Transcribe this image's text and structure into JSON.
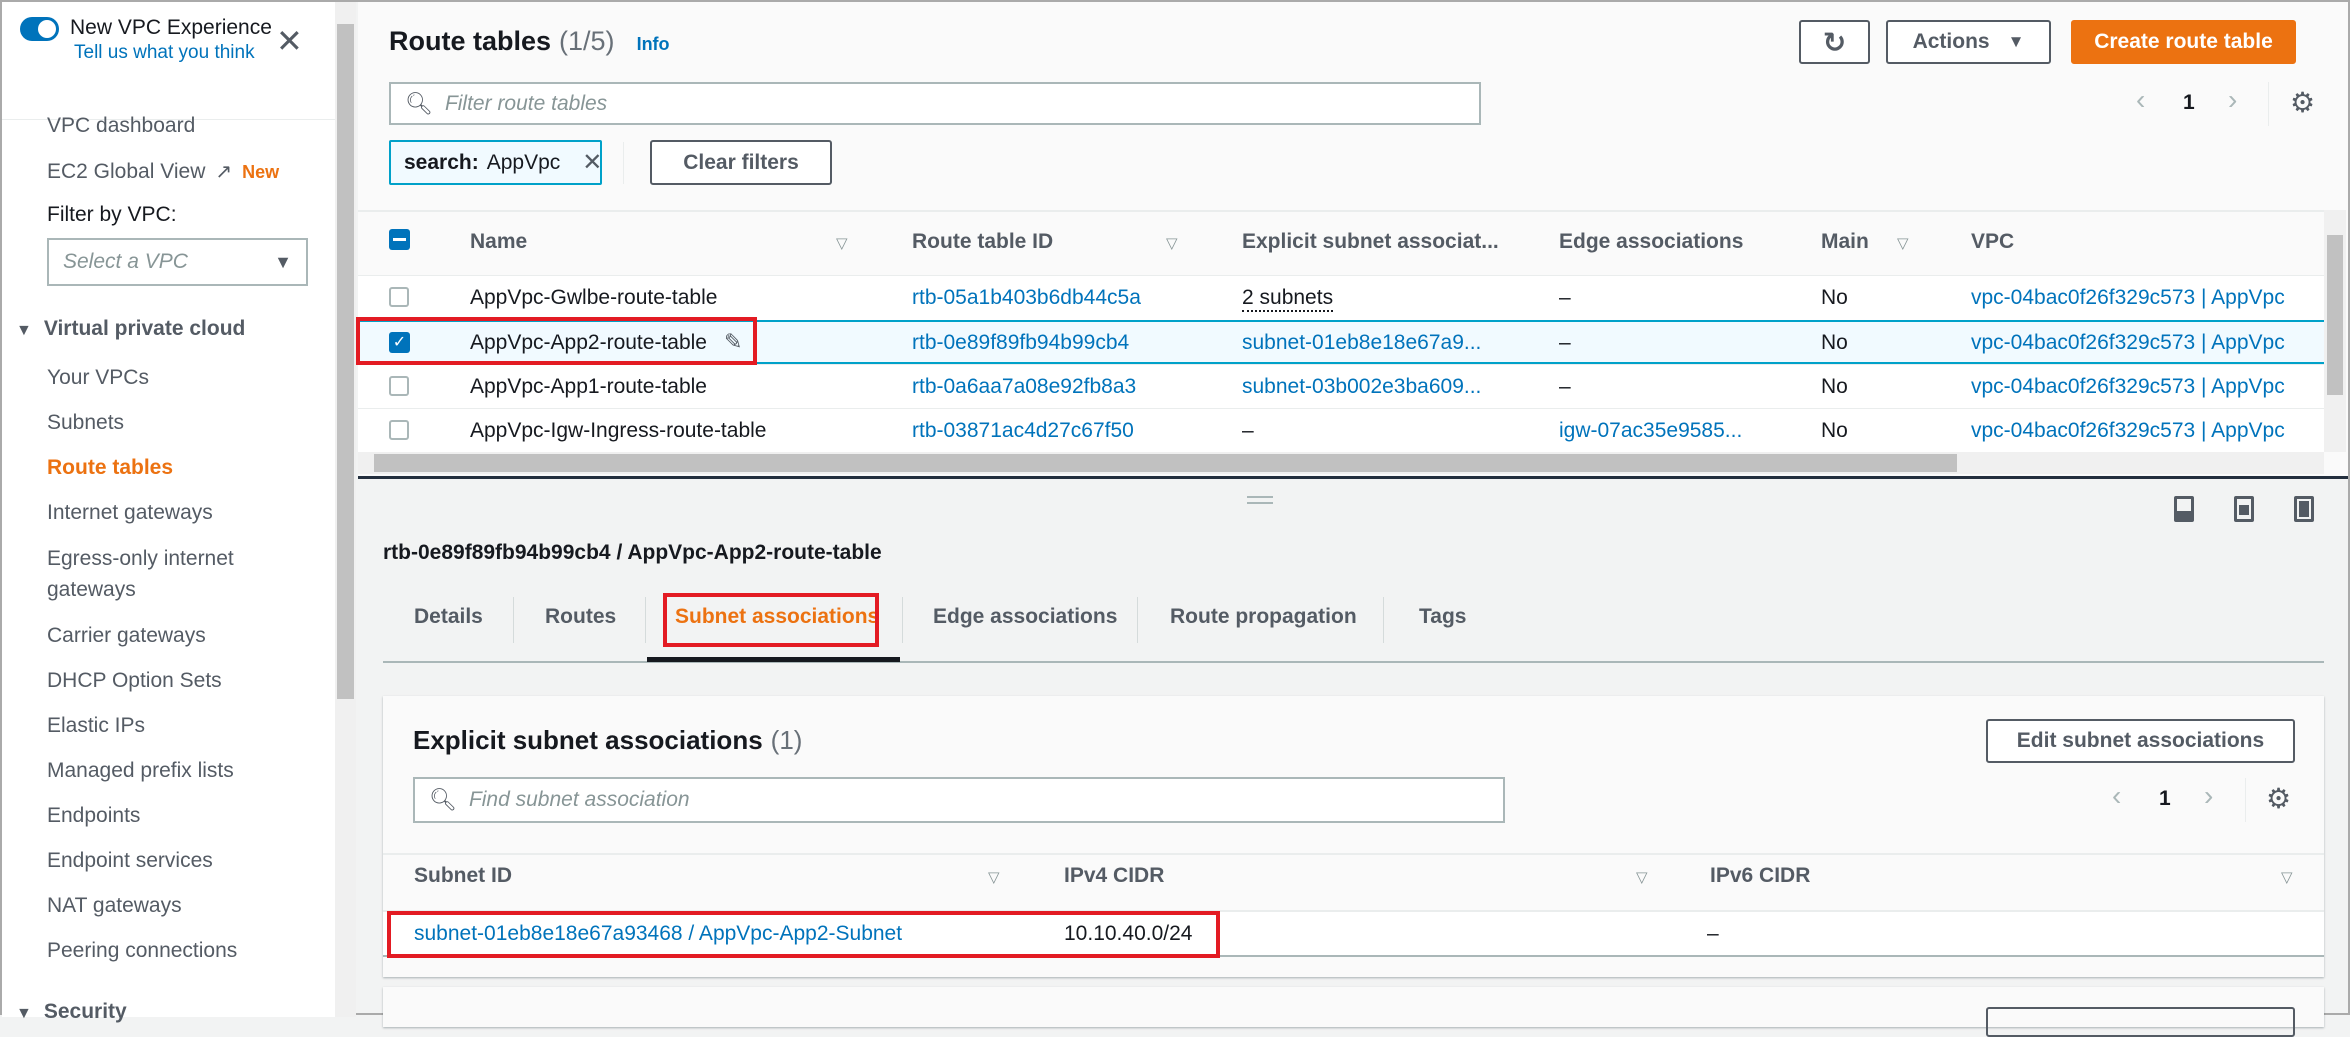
{
  "sidebar": {
    "experience_toggle": {
      "label": "New VPC Experience",
      "link": "Tell us what you think",
      "enabled": true
    },
    "items_top": [
      "VPC dashboard",
      "EC2 Global View"
    ],
    "new_badge": "New",
    "filter_label": "Filter by VPC:",
    "filter_placeholder": "Select a VPC",
    "section": "Virtual private cloud",
    "items": [
      "Your VPCs",
      "Subnets",
      "Route tables",
      "Internet gateways",
      "Egress-only internet gateways",
      "Carrier gateways",
      "DHCP Option Sets",
      "Elastic IPs",
      "Managed prefix lists",
      "Endpoints",
      "Endpoint services",
      "NAT gateways",
      "Peering connections"
    ],
    "active_item": "Route tables",
    "next_section": "Security"
  },
  "header": {
    "title": "Route tables",
    "count": "(1/5)",
    "info": "Info",
    "actions_label": "Actions",
    "create_label": "Create route table",
    "filter_placeholder": "Filter route tables",
    "page": "1",
    "token": {
      "key": "search:",
      "value": "AppVpc"
    },
    "clear_filters": "Clear filters"
  },
  "table": {
    "columns": [
      "Name",
      "Route table ID",
      "Explicit subnet associat...",
      "Edge associations",
      "Main",
      "VPC"
    ],
    "rows": [
      {
        "name": "AppVpc-Gwlbe-route-table",
        "id": "rtb-05a1b403b6db44c5a",
        "explicit": "2 subnets",
        "edge": "–",
        "main": "No",
        "vpc": "vpc-04bac0f26f329c573 | AppVpc",
        "selected": false
      },
      {
        "name": "AppVpc-App2-route-table",
        "id": "rtb-0e89f89fb94b99cb4",
        "explicit": "subnet-01eb8e18e67a9...",
        "edge": "–",
        "main": "No",
        "vpc": "vpc-04bac0f26f329c573 | AppVpc",
        "selected": true
      },
      {
        "name": "AppVpc-App1-route-table",
        "id": "rtb-0a6aa7a08e92fb8a3",
        "explicit": "subnet-03b002e3ba609...",
        "edge": "–",
        "main": "No",
        "vpc": "vpc-04bac0f26f329c573 | AppVpc",
        "selected": false
      },
      {
        "name": "AppVpc-Igw-Ingress-route-table",
        "id": "rtb-03871ac4d27c67f50",
        "explicit": "–",
        "edge": "igw-07ac35e9585...",
        "main": "No",
        "vpc": "vpc-04bac0f26f329c573 | AppVpc",
        "selected": false
      }
    ]
  },
  "detail": {
    "title": "rtb-0e89f89fb94b99cb4 / AppVpc-App2-route-table",
    "tabs": [
      "Details",
      "Routes",
      "Subnet associations",
      "Edge associations",
      "Route propagation",
      "Tags"
    ],
    "active_tab": "Subnet associations",
    "panel": {
      "title": "Explicit subnet associations",
      "count": "(1)",
      "edit_label": "Edit subnet associations",
      "search_placeholder": "Find subnet association",
      "page": "1",
      "columns": [
        "Subnet ID",
        "IPv4 CIDR",
        "IPv6 CIDR"
      ],
      "rows": [
        {
          "subnet": "subnet-01eb8e18e67a93468 / AppVpc-App2-Subnet",
          "ipv4": "10.10.40.0/24",
          "ipv6": "–"
        }
      ]
    }
  },
  "colors": {
    "accent": "#ec7211",
    "link": "#0073bb",
    "highlight": "#e31b23",
    "selected_row": "#f1faff"
  }
}
